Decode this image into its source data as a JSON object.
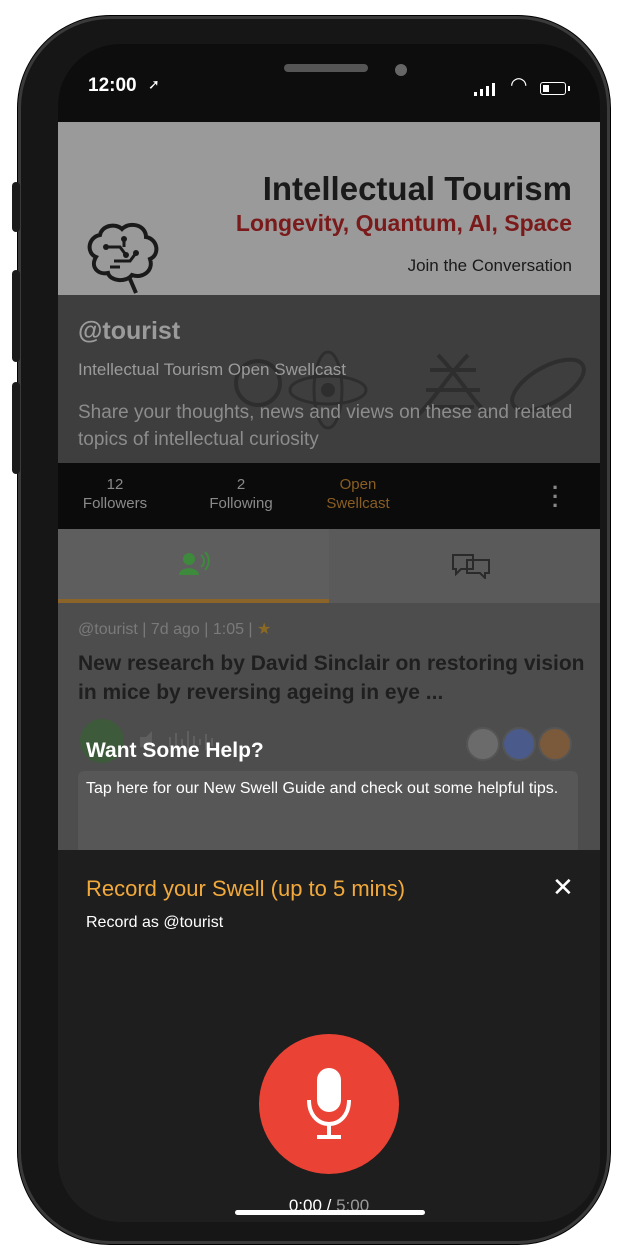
{
  "status_bar": {
    "time": "12:00",
    "location_glyph": "➚"
  },
  "banner": {
    "title": "Intellectual Tourism",
    "subtitle": "Longevity, Quantum, AI, Space",
    "cta": "Join the Conversation"
  },
  "profile": {
    "handle": "@tourist",
    "name": "Intellectual Tourism Open Swellcast",
    "description": "Share your thoughts, news and views on these and related topics of intellectual curiosity"
  },
  "stats": {
    "followers_count": "12",
    "followers_label": "Followers",
    "following_count": "2",
    "following_label": "Following",
    "type_line1": "Open",
    "type_line2": "Swellcast"
  },
  "tabs": [
    {
      "icon": "speaker-person-icon",
      "active": true
    },
    {
      "icon": "chat-bubbles-icon",
      "active": false
    }
  ],
  "feed": {
    "meta": "@tourist | 7d ago | 1:05 |",
    "meta_star": "★",
    "post_title": "New research by David Sinclair on restoring vision in mice by reversing ageing in eye ..."
  },
  "help": {
    "title": "Want Some Help?",
    "text": "Tap here for our New Swell Guide and check out some helpful tips."
  },
  "record": {
    "title": "Record your Swell (up to 5 mins)",
    "record_as": "Record as @tourist",
    "close_glyph": "✕",
    "elapsed": "0:00",
    "separator": " / ",
    "max": "5:00"
  },
  "colors": {
    "accent": "#f2a93b",
    "record_red": "#ea4335",
    "banner_subtitle": "#7a1a1a"
  }
}
